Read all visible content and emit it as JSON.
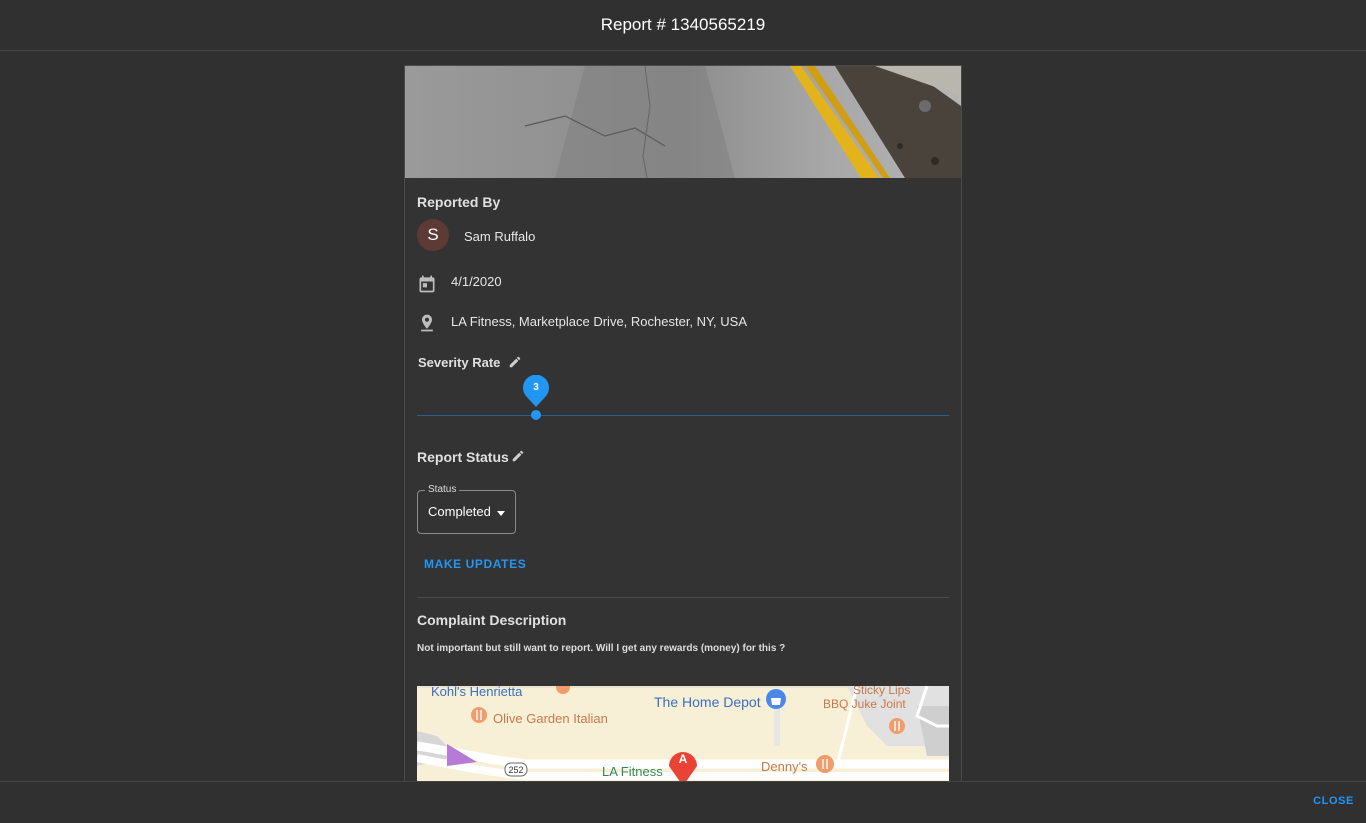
{
  "header": {
    "title": "Report # 1340565219"
  },
  "report": {
    "reported_by_heading": "Reported By",
    "reporter": {
      "initial": "S",
      "name": "Sam Ruffalo"
    },
    "date": "4/1/2020",
    "location": "LA Fitness, Marketplace Drive, Rochester, NY, USA",
    "severity_heading": "Severity Rate",
    "severity_value": "3",
    "status_heading": "Report Status",
    "status": {
      "legend": "Status",
      "value": "Completed"
    },
    "make_updates_label": "MAKE UPDATES",
    "complaint_heading": "Complaint Description",
    "complaint_text": "Not important but still want to report. Will I get any rewards (money) for this ?"
  },
  "map": {
    "labels": {
      "kohls": "Kohl's Henrietta",
      "olive_garden": "Olive Garden Italian",
      "home_depot": "The Home Depot",
      "sticky_lips_1": "Sticky Lips",
      "sticky_lips_2": "BBQ Juke Joint",
      "route": "252",
      "marker": "A",
      "la_fitness": "LA Fitness",
      "dennys": "Denny's"
    }
  },
  "footer": {
    "close_label": "CLOSE"
  },
  "colors": {
    "accent": "#2196f3",
    "background": "#303030",
    "avatar": "#5d3b34",
    "map_marker": "#ea4335"
  }
}
